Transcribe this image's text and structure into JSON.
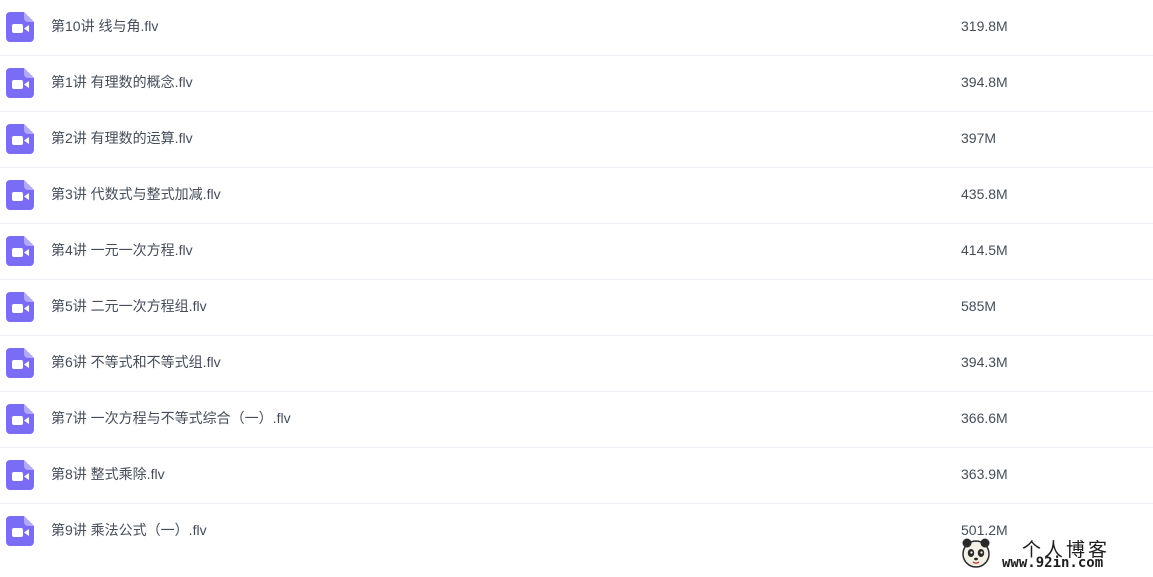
{
  "colors": {
    "icon_accent": "#7b6cf6",
    "text": "#454d5a",
    "row_divider": "#eceef3"
  },
  "file_icon": "video-file-icon",
  "files": [
    {
      "name": "第10讲 线与角.flv",
      "size": "319.8M"
    },
    {
      "name": "第1讲 有理数的概念.flv",
      "size": "394.8M"
    },
    {
      "name": "第2讲 有理数的运算.flv",
      "size": "397M"
    },
    {
      "name": "第3讲 代数式与整式加减.flv",
      "size": "435.8M"
    },
    {
      "name": "第4讲 一元一次方程.flv",
      "size": "414.5M"
    },
    {
      "name": "第5讲 二元一次方程组.flv",
      "size": "585M"
    },
    {
      "name": "第6讲 不等式和不等式组.flv",
      "size": "394.3M"
    },
    {
      "name": "第7讲 一次方程与不等式综合（一）.flv",
      "size": "366.6M"
    },
    {
      "name": "第8讲 整式乘除.flv",
      "size": "363.9M"
    },
    {
      "name": "第9讲 乘法公式（一）.flv",
      "size": "501.2M"
    }
  ],
  "watermark": {
    "title": "个人博客",
    "url": "www.92in.com"
  }
}
